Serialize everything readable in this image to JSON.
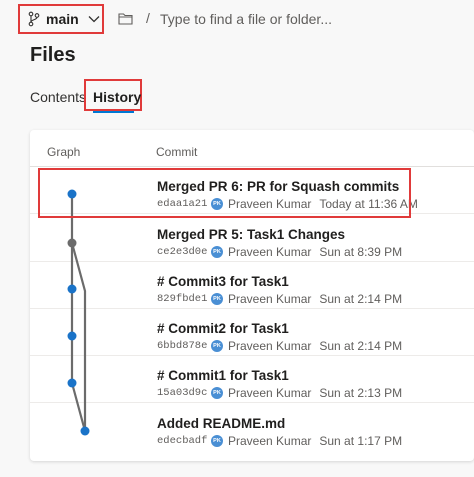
{
  "topbar": {
    "branch_name": "main",
    "branch_icon": "git-branch-icon",
    "chevron_icon": "chevron-down-icon",
    "folder_icon": "folder-icon",
    "path_separator": "/",
    "search_placeholder": "Type to find a file or folder..."
  },
  "page": {
    "title": "Files"
  },
  "tabs": [
    {
      "label": "Contents",
      "selected": false
    },
    {
      "label": "History",
      "selected": true
    }
  ],
  "table": {
    "columns": [
      "Graph",
      "Commit"
    ],
    "commits": [
      {
        "message": "Merged PR 6: PR for Squash commits",
        "hash": "edaa1a21",
        "avatar": "PK",
        "author": "Praveen Kumar",
        "time": "Today at 11:36 AM"
      },
      {
        "message": "Merged PR 5: Task1 Changes",
        "hash": "ce2e3d0e",
        "avatar": "PK",
        "author": "Praveen Kumar",
        "time": "Sun at 8:39 PM"
      },
      {
        "message": "# Commit3 for Task1",
        "hash": "829fbde1",
        "avatar": "PK",
        "author": "Praveen Kumar",
        "time": "Sun at 2:14 PM"
      },
      {
        "message": "# Commit2 for Task1",
        "hash": "6bbd878e",
        "avatar": "PK",
        "author": "Praveen Kumar",
        "time": "Sun at 2:14 PM"
      },
      {
        "message": "# Commit1 for Task1",
        "hash": "15a03d9c",
        "avatar": "PK",
        "author": "Praveen Kumar",
        "time": "Sun at 2:13 PM"
      },
      {
        "message": "Added README.md",
        "hash": "edecbadf",
        "avatar": "PK",
        "author": "Praveen Kumar",
        "time": "Sun at 1:17 PM"
      }
    ]
  },
  "colors": {
    "accent": "#0078d4",
    "highlight_box": "#e03a3a",
    "graph_node_blue": "#1a73c8",
    "graph_node_gray": "#6b6b6b"
  }
}
